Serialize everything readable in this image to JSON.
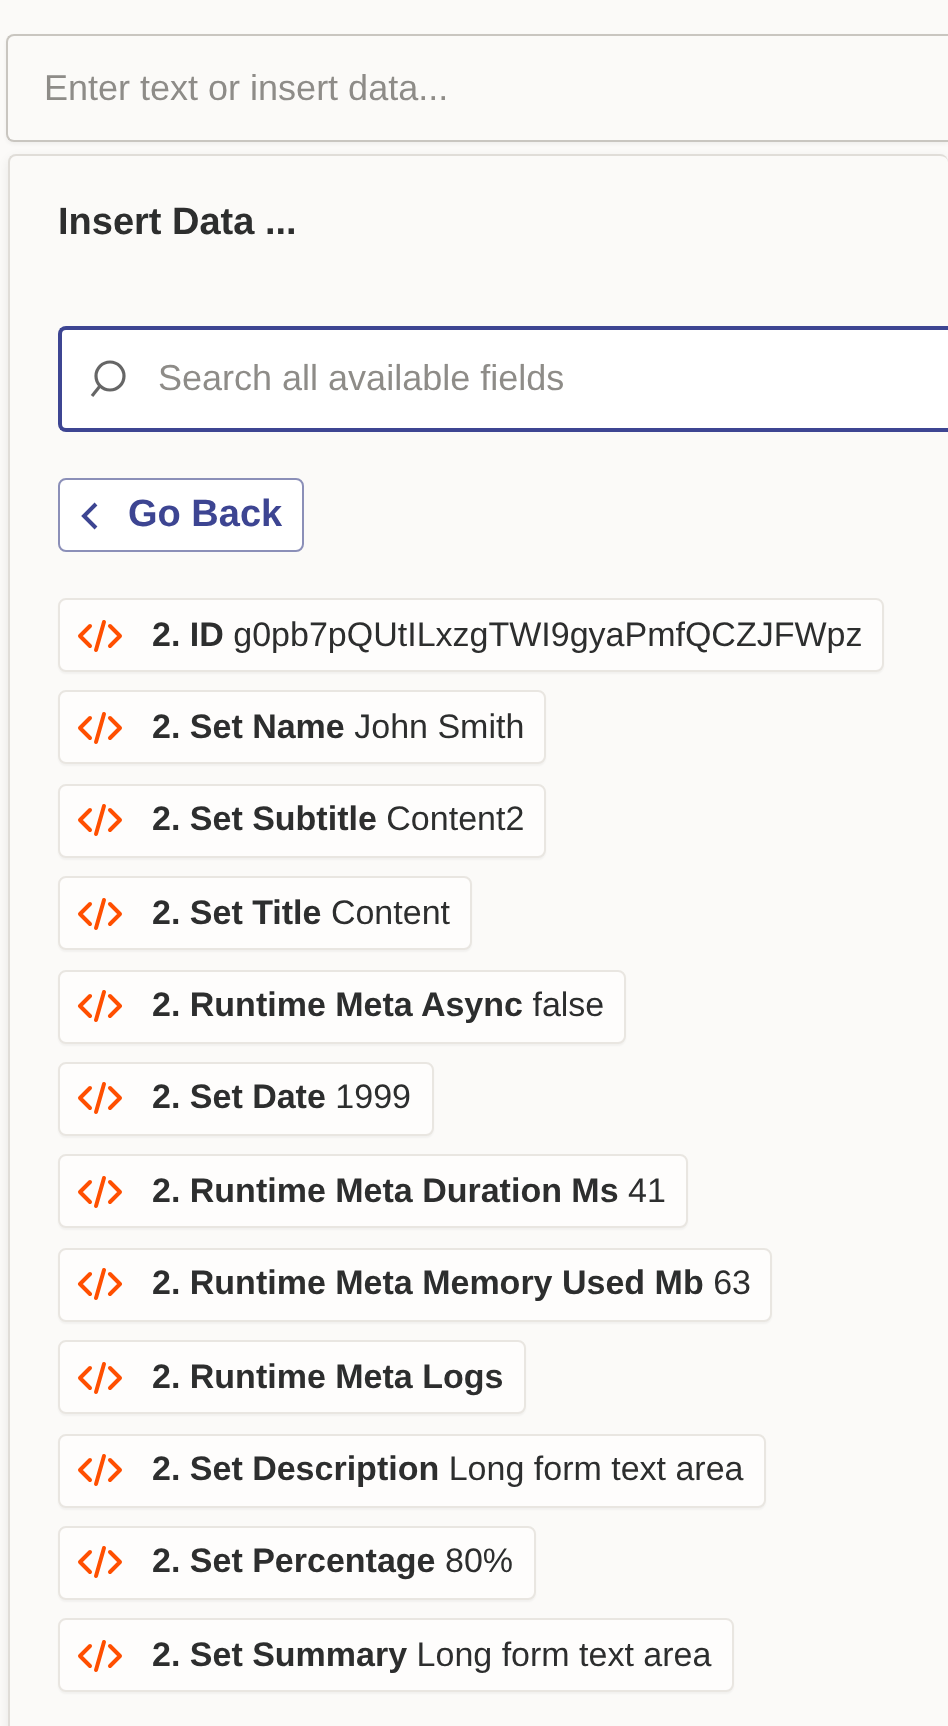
{
  "text_input": {
    "placeholder": "Enter text or insert data..."
  },
  "panel": {
    "title": "Insert Data ...",
    "search": {
      "placeholder": "Search all available fields"
    },
    "back_button": {
      "label": "Go Back"
    },
    "fields": [
      {
        "label": "2. ID",
        "value": "g0pb7pQUtILxzgTWI9gyaPmfQCZJFWpz"
      },
      {
        "label": "2. Set Name",
        "value": "John Smith"
      },
      {
        "label": "2. Set Subtitle",
        "value": "Content2"
      },
      {
        "label": "2. Set Title",
        "value": "Content"
      },
      {
        "label": "2. Runtime Meta Async",
        "value": "false"
      },
      {
        "label": "2. Set Date",
        "value": "1999"
      },
      {
        "label": "2. Runtime Meta Duration Ms",
        "value": "41"
      },
      {
        "label": "2. Runtime Meta Memory Used Mb",
        "value": "63"
      },
      {
        "label": "2. Runtime Meta Logs"
      },
      {
        "label": "2. Set Description",
        "value": "Long form text area"
      },
      {
        "label": "2. Set Percentage",
        "value": "80%"
      },
      {
        "label": "2. Set Summary",
        "value": "Long form text area"
      }
    ]
  }
}
